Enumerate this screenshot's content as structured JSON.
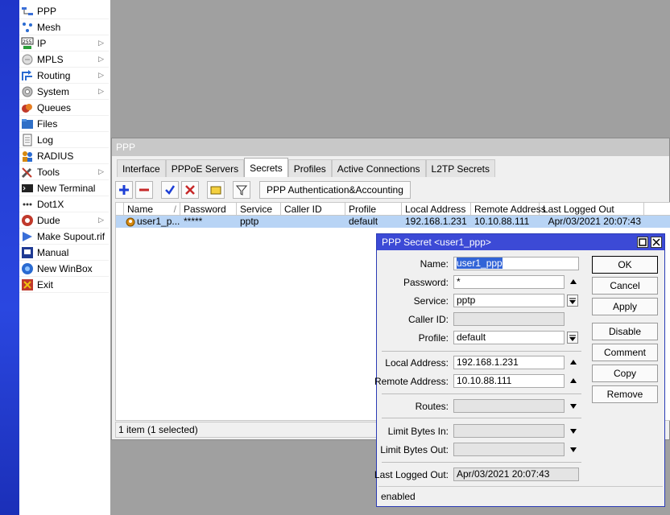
{
  "sidebar": {
    "items": [
      {
        "label": "PPP",
        "icon": "ppp-icon",
        "has_submenu": false
      },
      {
        "label": "Mesh",
        "icon": "mesh-icon",
        "has_submenu": false
      },
      {
        "label": "IP",
        "icon": "ip-icon",
        "has_submenu": true
      },
      {
        "label": "MPLS",
        "icon": "mpls-icon",
        "has_submenu": true
      },
      {
        "label": "Routing",
        "icon": "routing-icon",
        "has_submenu": true
      },
      {
        "label": "System",
        "icon": "system-gear-icon",
        "has_submenu": true
      },
      {
        "label": "Queues",
        "icon": "queues-icon",
        "has_submenu": false
      },
      {
        "label": "Files",
        "icon": "files-folder-icon",
        "has_submenu": false
      },
      {
        "label": "Log",
        "icon": "log-icon",
        "has_submenu": false
      },
      {
        "label": "RADIUS",
        "icon": "radius-users-icon",
        "has_submenu": false
      },
      {
        "label": "Tools",
        "icon": "tools-icon",
        "has_submenu": true
      },
      {
        "label": "New Terminal",
        "icon": "terminal-icon",
        "has_submenu": false
      },
      {
        "label": "Dot1X",
        "icon": "dot1x-icon",
        "has_submenu": false
      },
      {
        "label": "Dude",
        "icon": "dude-icon",
        "has_submenu": true
      },
      {
        "label": "Make Supout.rif",
        "icon": "supout-icon",
        "has_submenu": false
      },
      {
        "label": "Manual",
        "icon": "manual-icon",
        "has_submenu": false
      },
      {
        "label": "New WinBox",
        "icon": "winbox-icon",
        "has_submenu": false
      },
      {
        "label": "Exit",
        "icon": "exit-icon",
        "has_submenu": false
      }
    ],
    "submenu_arrow": "▷"
  },
  "ppp_window": {
    "title": "PPP",
    "tabs": [
      "Interface",
      "PPPoE Servers",
      "Secrets",
      "Profiles",
      "Active Connections",
      "L2TP Secrets"
    ],
    "active_tab": "Secrets",
    "toolbar": {
      "auth_button": "PPP Authentication&Accounting"
    },
    "table": {
      "columns": [
        "Name",
        "Password",
        "Service",
        "Caller ID",
        "Profile",
        "Local Address",
        "Remote Address",
        "Last Logged Out"
      ],
      "sort_indicator": "/",
      "rows": [
        {
          "name": "user1_p...",
          "password": "*****",
          "service": "pptp",
          "caller_id": "",
          "profile": "default",
          "local_address": "192.168.1.231",
          "remote_address": "10.10.88.111",
          "last_logged_out": "Apr/03/2021 20:07:43"
        }
      ]
    },
    "status": "1 item (1 selected)"
  },
  "secret_dialog": {
    "title": "PPP Secret <user1_ppp>",
    "fields": {
      "name_label": "Name:",
      "name_value": "user1_ppp",
      "password_label": "Password:",
      "password_value": "*",
      "service_label": "Service:",
      "service_value": "pptp",
      "caller_id_label": "Caller ID:",
      "caller_id_value": "",
      "profile_label": "Profile:",
      "profile_value": "default",
      "local_address_label": "Local Address:",
      "local_address_value": "192.168.1.231",
      "remote_address_label": "Remote Address:",
      "remote_address_value": "10.10.88.111",
      "routes_label": "Routes:",
      "routes_value": "",
      "limit_in_label": "Limit Bytes In:",
      "limit_in_value": "",
      "limit_out_label": "Limit Bytes Out:",
      "limit_out_value": "",
      "last_logged_out_label": "Last Logged Out:",
      "last_logged_out_value": "Apr/03/2021 20:07:43"
    },
    "buttons": {
      "ok": "OK",
      "cancel": "Cancel",
      "apply": "Apply",
      "disable": "Disable",
      "comment": "Comment",
      "copy": "Copy",
      "remove": "Remove"
    },
    "status": "enabled"
  },
  "colors": {
    "dialog_title_bg": "#3c4ad6",
    "selection_bg": "#3264d7",
    "row_selected_bg": "#b8d4f5",
    "strip_blue": "#2a47e0"
  }
}
